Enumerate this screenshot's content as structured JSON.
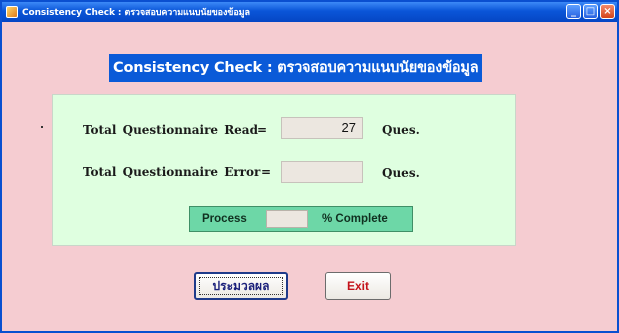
{
  "window": {
    "title": "Consistency Check : ตรวจสอบความแนบนัยของข้อมูล",
    "controls": [
      "minimize",
      "maximize",
      "close"
    ]
  },
  "heading": "Consistency Check : ตรวจสอบความแนบนัยของข้อมูล",
  "rows": [
    {
      "label": "Total  Questionnaire  Read",
      "equals": "=",
      "value": "27",
      "unit": "Ques."
    },
    {
      "label": "Total  Questionnaire  Error",
      "equals": "=",
      "value": "",
      "unit": "Ques."
    }
  ],
  "progress": {
    "label": "Process",
    "value": "",
    "suffix": "% Complete"
  },
  "buttons": {
    "process_label": "ประมวลผล",
    "exit_label": "Exit"
  },
  "colors": {
    "window_bg": "#f5ccd1",
    "panel_bg": "#dfffe0",
    "heading_bg": "#0a5ad8",
    "progress_bg": "#6dd7a7",
    "exit_text": "#c4121a"
  }
}
